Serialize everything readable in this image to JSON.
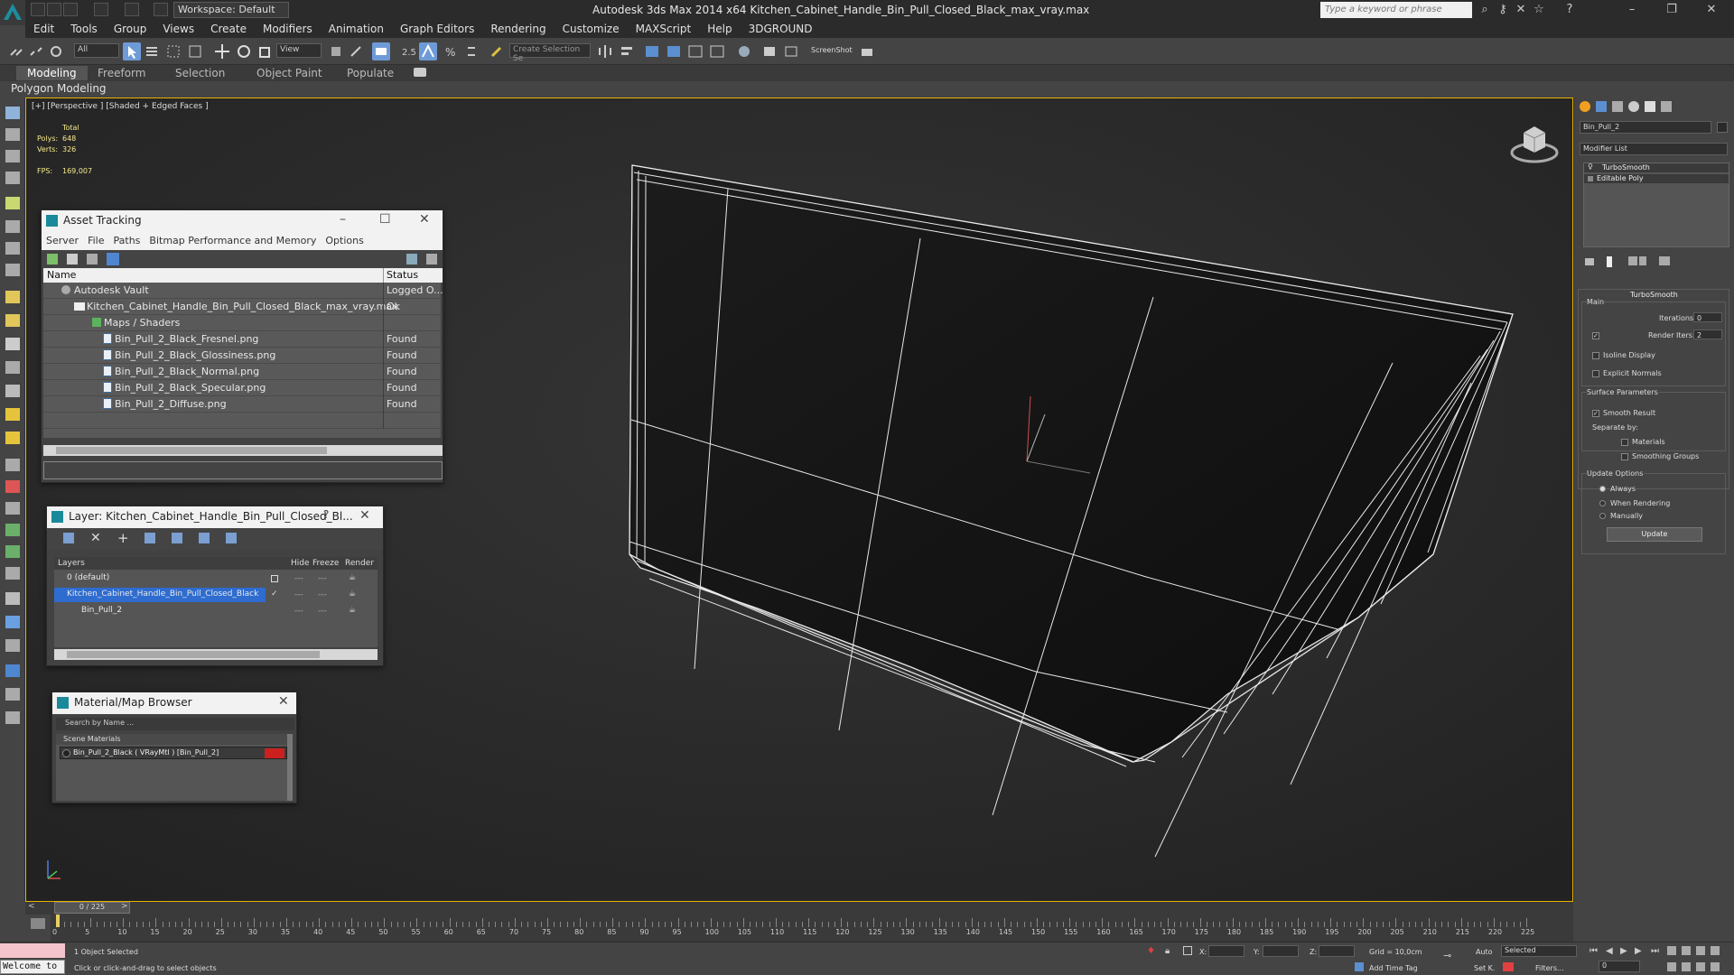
{
  "titlebar": {
    "workspace": "Workspace: Default",
    "title": "Autodesk 3ds Max  2014 x64      Kitchen_Cabinet_Handle_Bin_Pull_Closed_Black_max_vray.max",
    "search_placeholder": "Type a keyword or phrase"
  },
  "menubar": [
    "Edit",
    "Tools",
    "Group",
    "Views",
    "Create",
    "Modifiers",
    "Animation",
    "Graph Editors",
    "Rendering",
    "Customize",
    "MAXScript",
    "Help",
    "3DGROUND"
  ],
  "toolbar": {
    "filter_value": "All",
    "coord_value": "View",
    "selection_set_placeholder": "Create Selection Se",
    "screenshot_label": "ScreenShot"
  },
  "ribbon": {
    "tabs": [
      "Modeling",
      "Freeform",
      "Selection",
      "Object Paint",
      "Populate"
    ],
    "active_tab": "Modeling",
    "panel_label": "Polygon Modeling"
  },
  "viewport": {
    "label": "[+] [Perspective ] [Shaded + Edged Faces ]",
    "stats": {
      "total_label": "Total",
      "polys_label": "Polys:",
      "polys_value": "648",
      "verts_label": "Verts:",
      "verts_value": "326",
      "fps_label": "FPS:",
      "fps_value": "169,007"
    }
  },
  "asset_tracking": {
    "title": "Asset Tracking",
    "menu": [
      "Server",
      "File",
      "Paths",
      "Bitmap Performance and Memory",
      "Options"
    ],
    "columns": [
      "Name",
      "Status"
    ],
    "rows": [
      {
        "name": "Autodesk Vault",
        "status": "Logged O..."
      },
      {
        "name": "Kitchen_Cabinet_Handle_Bin_Pull_Closed_Black_max_vray.max",
        "status": "Ok"
      },
      {
        "name": "Maps / Shaders",
        "status": ""
      },
      {
        "name": "Bin_Pull_2_Black_Fresnel.png",
        "status": "Found"
      },
      {
        "name": "Bin_Pull_2_Black_Glossiness.png",
        "status": "Found"
      },
      {
        "name": "Bin_Pull_2_Black_Normal.png",
        "status": "Found"
      },
      {
        "name": "Bin_Pull_2_Black_Specular.png",
        "status": "Found"
      },
      {
        "name": "Bin_Pull_2_Diffuse.png",
        "status": "Found"
      }
    ]
  },
  "layer_window": {
    "title": "Layer: Kitchen_Cabinet_Handle_Bin_Pull_Closed_Bl...",
    "columns": [
      "Layers",
      "Hide",
      "Freeze",
      "Render"
    ],
    "rows": [
      {
        "name": "0 (default)"
      },
      {
        "name": "Kitchen_Cabinet_Handle_Bin_Pull_Closed_Black"
      },
      {
        "name": "Bin_Pull_2"
      }
    ]
  },
  "material_browser": {
    "title": "Material/Map Browser",
    "search_placeholder": "Search by Name ...",
    "group": "Scene Materials",
    "item": "Bin_Pull_2_Black  ( VRayMtl )  [Bin_Pull_2]"
  },
  "command_panel": {
    "object_name": "Bin_Pull_2",
    "modifier_list": "Modifier List",
    "stack": [
      "TurboSmooth",
      "Editable Poly"
    ],
    "rollout_title": "TurboSmooth",
    "main_label": "Main",
    "iterations_label": "Iterations:",
    "iterations_value": "0",
    "render_iters_label": "Render Iters:",
    "render_iters_value": "2",
    "isoline_label": "Isoline Display",
    "explicit_normals_label": "Explicit Normals",
    "surface_params_label": "Surface Parameters",
    "smooth_result_label": "Smooth Result",
    "separate_by_label": "Separate by:",
    "materials_label": "Materials",
    "smoothing_groups_label": "Smoothing Groups",
    "update_options_label": "Update Options",
    "always_label": "Always",
    "when_rendering_label": "When Rendering",
    "manually_label": "Manually",
    "update_button": "Update"
  },
  "timeline": {
    "frame_counter": "0 / 225",
    "ticks": [
      "0",
      "5",
      "10",
      "15",
      "20",
      "25",
      "30",
      "35",
      "40",
      "45",
      "50",
      "55",
      "60",
      "65",
      "70",
      "75",
      "80",
      "85",
      "90",
      "95",
      "100",
      "105",
      "110",
      "115",
      "120",
      "125",
      "130",
      "135",
      "140",
      "145",
      "150",
      "155",
      "160",
      "165",
      "170",
      "175",
      "180",
      "185",
      "190",
      "195",
      "200",
      "205",
      "210",
      "215",
      "220",
      "225"
    ]
  },
  "statusbar": {
    "maxscript_text": "Welcome to",
    "selection_status": "1 Object Selected",
    "prompt": "Click or click-and-drag to select objects",
    "x_label": "X:",
    "y_label": "Y:",
    "z_label": "Z:",
    "grid": "Grid = 10,0cm",
    "add_time_tag": "Add Time Tag",
    "auto_label": "Auto",
    "set_key_label": "Set K.",
    "selected_value": "Selected",
    "filters_label": "Filters...",
    "frame_value": "0"
  },
  "colors": {
    "viewport_border": "#e8b200",
    "selection_blue": "#2e6cd0",
    "stats_yellow": "#f5e98a"
  }
}
